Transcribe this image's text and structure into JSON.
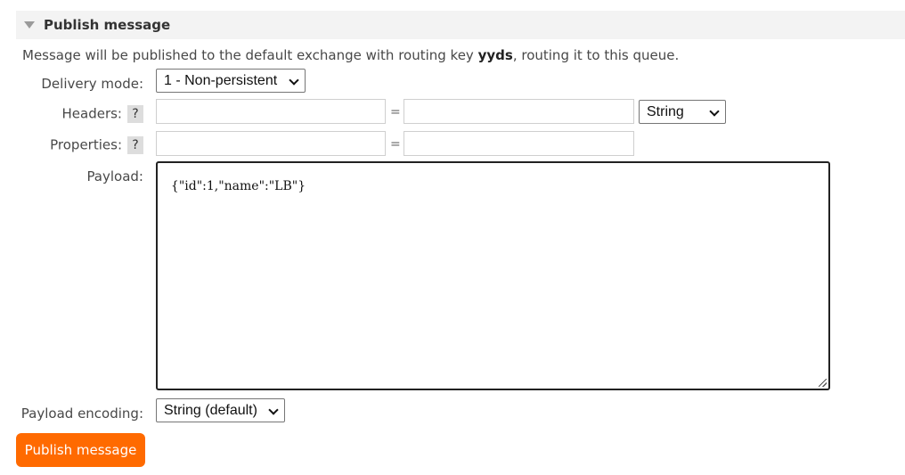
{
  "section": {
    "title": "Publish message"
  },
  "info": {
    "prefix": "Message will be published to the default exchange with routing key ",
    "routing_key": "yyds",
    "suffix": ", routing it to this queue."
  },
  "delivery_mode": {
    "label": "Delivery mode:",
    "selected": "1 - Non-persistent"
  },
  "headers": {
    "label": "Headers:",
    "help": "?",
    "key_value": "",
    "equals": "=",
    "value_value": "",
    "type_selected": "String"
  },
  "properties": {
    "label": "Properties:",
    "help": "?",
    "key_value": "",
    "equals": "=",
    "value_value": ""
  },
  "payload": {
    "label": "Payload:",
    "value": "{\"id\":1,\"name\":\"LB\"}"
  },
  "payload_encoding": {
    "label": "Payload encoding:",
    "selected": "String (default)"
  },
  "publish_button": {
    "label": "Publish message"
  },
  "colors": {
    "accent": "#ff6a00",
    "header_bg": "#f3f3f3"
  }
}
